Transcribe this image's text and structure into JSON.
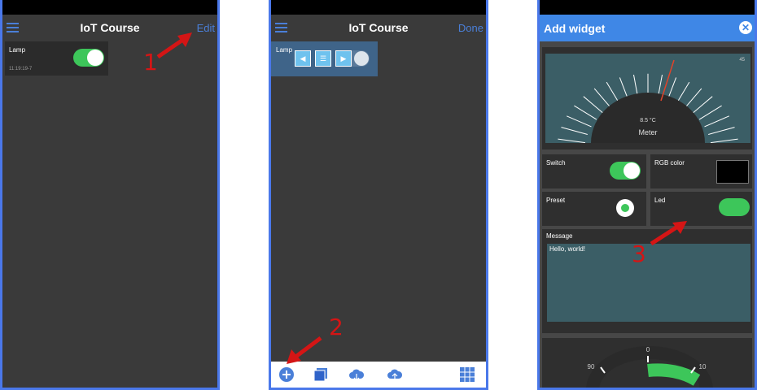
{
  "panel1": {
    "title": "IoT Course",
    "action": "Edit",
    "widget": {
      "label": "Lamp",
      "timestamp": "11:19:19-7",
      "state": "on"
    }
  },
  "panel2": {
    "title": "IoT Course",
    "action": "Done",
    "widget": {
      "label": "Lamp"
    },
    "edit_buttons": [
      "◀",
      "☰",
      "▶"
    ],
    "toolbar_icons": [
      "add-circle-icon",
      "copy-icon",
      "cloud-download-icon",
      "cloud-upload-icon",
      "grid-icon"
    ]
  },
  "panel3": {
    "title": "Add widget",
    "close_glyph": "✕",
    "meter": {
      "value_text": "8.5 °C",
      "label": "Meter",
      "corner": "45"
    },
    "tiles": {
      "switch": "Switch",
      "rgb": "RGB color",
      "preset": "Preset",
      "led": "Led",
      "message": "Message",
      "message_value": "Hello, world!"
    },
    "gauge_ticks": [
      "0",
      "10",
      "90"
    ]
  },
  "annotations": [
    "1",
    "2",
    "3"
  ],
  "colors": {
    "accent": "#4a7fd8",
    "toggle_on": "#3dc65a",
    "arrow": "#d41515",
    "header": "#3f87e6"
  }
}
